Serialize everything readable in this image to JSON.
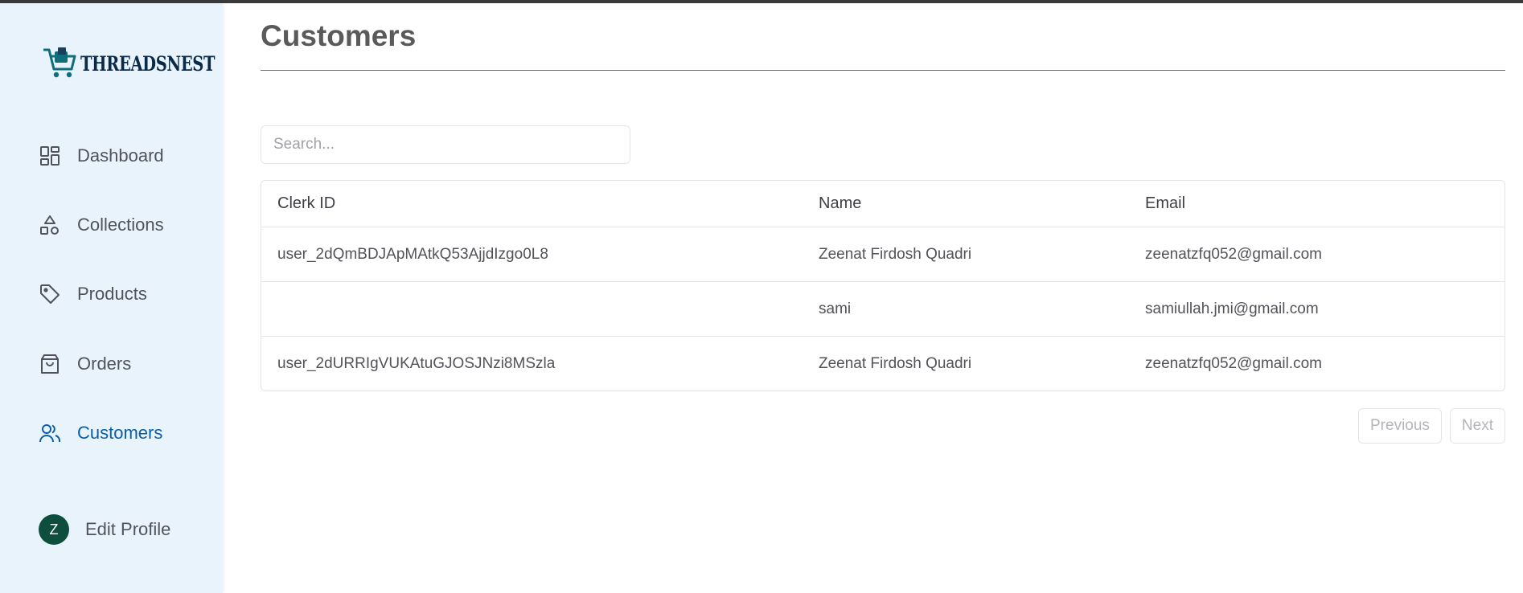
{
  "app": {
    "brand": "THREADSNEST"
  },
  "sidebar": {
    "items": [
      {
        "label": "Dashboard",
        "icon": "dashboard-icon"
      },
      {
        "label": "Collections",
        "icon": "shapes-icon"
      },
      {
        "label": "Products",
        "icon": "tag-icon"
      },
      {
        "label": "Orders",
        "icon": "shopping-bag-icon"
      },
      {
        "label": "Customers",
        "icon": "users-icon",
        "active": true
      }
    ],
    "profile": {
      "initial": "Z",
      "label": "Edit Profile"
    }
  },
  "page": {
    "title": "Customers"
  },
  "search": {
    "placeholder": "Search..."
  },
  "table": {
    "headers": [
      "Clerk ID",
      "Name",
      "Email"
    ],
    "rows": [
      [
        "user_2dQmBDJApMAtkQ53AjjdIzgo0L8",
        "Zeenat Firdosh Quadri",
        "zeenatzfq052@gmail.com"
      ],
      [
        "",
        "sami",
        "samiullah.jmi@gmail.com"
      ],
      [
        "user_2dURRIgVUKAtuGJOSJNzi8MSzla",
        "Zeenat Firdosh Quadri",
        "zeenatzfq052@gmail.com"
      ]
    ]
  },
  "pagination": {
    "previous": "Previous",
    "next": "Next"
  },
  "colors": {
    "accent": "#0b5ea8",
    "sidebar_bg": "#e8f3fc",
    "avatar_bg": "#0d4f3c",
    "logo": "#0a2a4a"
  }
}
